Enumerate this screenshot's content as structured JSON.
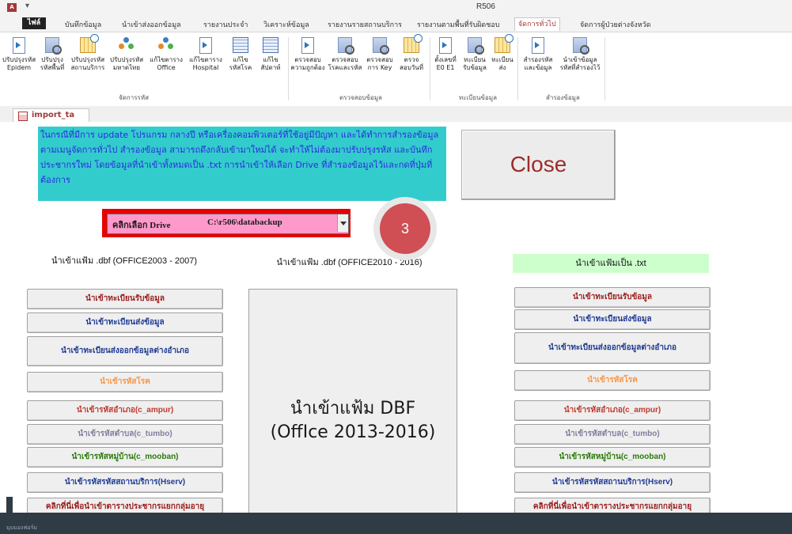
{
  "window": {
    "title": "R506",
    "app_icon": "A"
  },
  "ribbon_tabs": [
    {
      "label": "ไฟล์"
    },
    {
      "label": "บันทึกข้อมูล"
    },
    {
      "label": "นำเข้าส่งออกข้อมูล"
    },
    {
      "label": "รายงานประจำ"
    },
    {
      "label": "วิเคราะห์ข้อมูล"
    },
    {
      "label": "รายงานรายสถานบริการ"
    },
    {
      "label": "รายงานตามพื้นที่รับผิดชอบ"
    },
    {
      "label": "จัดการทั่วไป"
    },
    {
      "label": "จัดการผู้ป่วยต่างจังหวัด"
    }
  ],
  "ribbon_buttons": [
    {
      "l1": "ปรับปรุงรหัส",
      "l2": "Epidem",
      "icon": "page-icon"
    },
    {
      "l1": "ปรับปรุง",
      "l2": "รหัสพื้นที่",
      "icon": "query-icon"
    },
    {
      "l1": "ปรับปรุงรหัส",
      "l2": "สถานบริการ",
      "icon": "calendar-icon"
    },
    {
      "l1": "ปรับปรุงรหัส",
      "l2": "มหาดไทย",
      "icon": "people-icon"
    },
    {
      "l1": "แก้ไขตาราง",
      "l2": "Office",
      "icon": "people-icon"
    },
    {
      "l1": "แก้ไขตาราง",
      "l2": "Hospital",
      "icon": "page-icon"
    },
    {
      "l1": "แก้ไข",
      "l2": "รหัสโรค",
      "icon": "table-icon"
    },
    {
      "l1": "แก้ไข",
      "l2": "สัปดาห์",
      "icon": "table-icon"
    },
    {
      "l1": "ตรวจสอบ",
      "l2": "ความถูกต้อง",
      "icon": "page-icon"
    },
    {
      "l1": "ตรวจสอบ",
      "l2": "โรคและรหัส",
      "icon": "query-icon"
    },
    {
      "l1": "ตรวจสอบ",
      "l2": "การ Key",
      "icon": "query-icon"
    },
    {
      "l1": "ตรวจ",
      "l2": "สอบวันที่",
      "icon": "calendar-icon"
    },
    {
      "l1": "ตั้งเลขที่",
      "l2": "E0 E1",
      "icon": "page-icon"
    },
    {
      "l1": "ทะเบียน",
      "l2": "รับข้อมูล",
      "icon": "query-icon"
    },
    {
      "l1": "ทะเบียน",
      "l2": "ส่ง",
      "icon": "calendar-icon"
    },
    {
      "l1": "สำรองรหัส",
      "l2": "และข้อมูล",
      "icon": "page-icon"
    },
    {
      "l1": "นำเข้าข้อมูล",
      "l2": "รหัสที่สำรองไว้",
      "icon": "query-icon"
    }
  ],
  "ribbon_groups": [
    "จัดการรหัส",
    "ตรวจสอบข้อมูล",
    "ทะเบียนข้อมูล",
    "สำรองข้อมูล"
  ],
  "object_tab": {
    "label": "import_ta"
  },
  "info_text": "ในกรณีที่มีการ update โปรแกรม กลางปี  หรือเครื่องคอมพิวเตอร์ที่ใช้อยู่มีปัญหา และได้ทำการสำรองข้อมูลตามเมนูจัดการทั่วไป สำรองข้อมูล สามารถดึงกลับเข้ามาใหม่ได้ จะทำให้ไม่ต้องมาปรับปรุงรหัส และบันทึกประชากรใหม่ โดยข้อมูลที่นำเข้าทั้งหมดเป็น .txt การนำเข้าให้เลือก Drive ที่สำรองข้อมูลไว้และกดที่ปุ่มที่ต้องการ",
  "close_label": "Close",
  "drive": {
    "label": "คลิกเลือก Drive",
    "value": "C:\\r506\\databackup"
  },
  "badge": "3",
  "headers": {
    "left": "นำเข้าแฟ้ม .dbf (OFFICE2003 - 2007)",
    "mid": "นำเข้าแฟ้ม .dbf (OFFICE2010 - 2016)",
    "right": "นำเข้าแฟ้มเป็น .txt"
  },
  "import_buttons": [
    "นำเข้าทะเบียนรับข้อมูล",
    "นำเข้าทะเบียนส่งข้อมูล",
    "นำเข้าทะเบียนส่งออกข้อมูลต่างอำเภอ",
    "นำเข้ารหัสโรค",
    "นำเข้ารหัสอำเภอ(c_ampur)",
    "นำเข้ารหัสตำบล(c_tumbo)",
    "นำเข้ารหัสหมู่บ้าน(c_mooban)",
    "นำเข้ารหัสรหัสสถานบริการ(Hserv)",
    "คลิกที่นี่เพื่อนำเข้าตารางประชากรแยกกลุ่มอายุ"
  ],
  "big_button": {
    "line1": "นำเข้าแฟ้ม DBF",
    "line2": "(OffIce 2013-2016)"
  },
  "status_text": "มุมมองฟอร์ม",
  "colors": {
    "accent": "#a4373a",
    "info_bg": "#33cccc",
    "info_text": "#2b2be0",
    "drive_border": "#e60000",
    "drive_bg": "#ff99cc",
    "badge": "#cf4f54",
    "txt_header_bg": "#ccffcc"
  }
}
